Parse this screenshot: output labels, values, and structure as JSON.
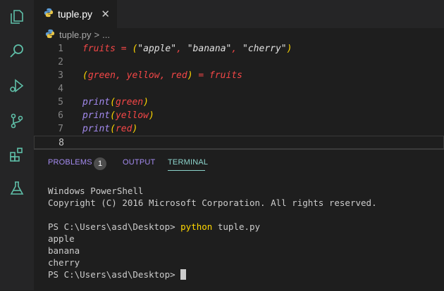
{
  "colors": {
    "keyword": "#f44747",
    "string": "#e2e2e2",
    "function": "#a48bf0",
    "paren": "#ffd700",
    "icon": "#5fbfa8",
    "accent": "#8dd4cc"
  },
  "tab": {
    "label": "tuple.py",
    "close": "✕"
  },
  "breadcrumb": {
    "file": "tuple.py",
    "separator": ">",
    "more": "..."
  },
  "editor": {
    "lines": [
      {
        "num": "1",
        "tokens": [
          {
            "t": "fruits",
            "c": "keyword"
          },
          {
            "t": " = ",
            "c": "keyword"
          },
          {
            "t": "(",
            "c": "paren"
          },
          {
            "t": "\"apple\"",
            "c": "string"
          },
          {
            "t": ", ",
            "c": "keyword"
          },
          {
            "t": "\"banana\"",
            "c": "string"
          },
          {
            "t": ", ",
            "c": "keyword"
          },
          {
            "t": "\"cherry\"",
            "c": "string"
          },
          {
            "t": ")",
            "c": "paren"
          }
        ]
      },
      {
        "num": "2",
        "tokens": []
      },
      {
        "num": "3",
        "tokens": [
          {
            "t": "(",
            "c": "paren"
          },
          {
            "t": "green, yellow, red",
            "c": "keyword"
          },
          {
            "t": ")",
            "c": "paren"
          },
          {
            "t": " = fruits",
            "c": "keyword"
          }
        ]
      },
      {
        "num": "4",
        "tokens": []
      },
      {
        "num": "5",
        "tokens": [
          {
            "t": "print",
            "c": "function"
          },
          {
            "t": "(",
            "c": "paren"
          },
          {
            "t": "green",
            "c": "keyword"
          },
          {
            "t": ")",
            "c": "paren"
          }
        ]
      },
      {
        "num": "6",
        "tokens": [
          {
            "t": "print",
            "c": "function"
          },
          {
            "t": "(",
            "c": "paren"
          },
          {
            "t": "yellow",
            "c": "keyword"
          },
          {
            "t": ")",
            "c": "paren"
          }
        ]
      },
      {
        "num": "7",
        "tokens": [
          {
            "t": "print",
            "c": "function"
          },
          {
            "t": "(",
            "c": "paren"
          },
          {
            "t": "red",
            "c": "keyword"
          },
          {
            "t": ")",
            "c": "paren"
          }
        ]
      },
      {
        "num": "8",
        "tokens": []
      }
    ]
  },
  "panel": {
    "problems": "PROBLEMS",
    "problems_count": "1",
    "output": "OUTPUT",
    "terminal": "TERMINAL"
  },
  "terminal": {
    "lines": [
      {
        "segs": [
          {
            "t": "Windows PowerShell"
          }
        ]
      },
      {
        "segs": [
          {
            "t": "Copyright (C) 2016 Microsoft Corporation. All rights reserved."
          }
        ]
      },
      {
        "segs": []
      },
      {
        "segs": [
          {
            "t": "PS C:\\Users\\asd\\Desktop> "
          },
          {
            "t": "python",
            "hl": true
          },
          {
            "t": " tuple.py"
          }
        ]
      },
      {
        "segs": [
          {
            "t": "apple"
          }
        ]
      },
      {
        "segs": [
          {
            "t": "banana"
          }
        ]
      },
      {
        "segs": [
          {
            "t": "cherry"
          }
        ]
      },
      {
        "segs": [
          {
            "t": "PS C:\\Users\\asd\\Desktop> "
          }
        ],
        "cursor": true
      }
    ]
  }
}
